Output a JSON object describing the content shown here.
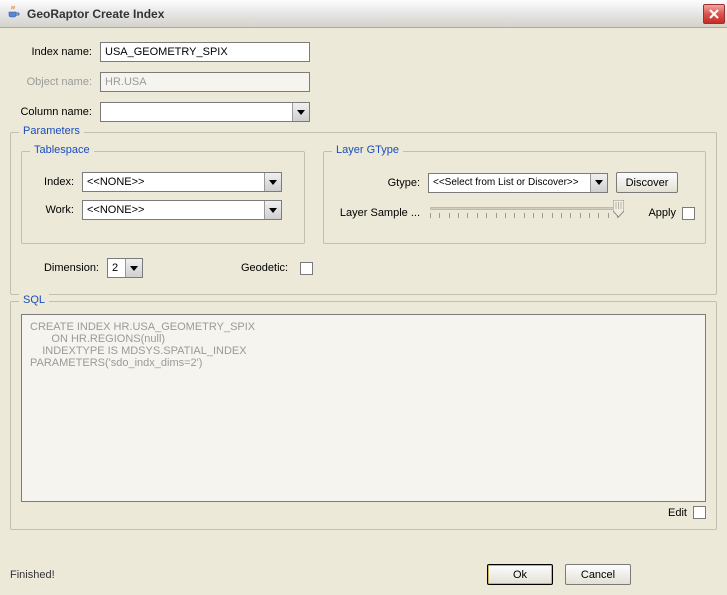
{
  "window": {
    "title": "GeoRaptor Create Index"
  },
  "form": {
    "index_name_label": "Index name:",
    "index_name_value": "USA_GEOMETRY_SPIX",
    "object_name_label": "Object name:",
    "object_name_value": "HR.USA",
    "column_name_label": "Column name:",
    "column_name_value": ""
  },
  "parameters": {
    "legend": "Parameters",
    "tablespace": {
      "legend": "Tablespace",
      "index_label": "Index:",
      "index_value": "<<NONE>>",
      "work_label": "Work:",
      "work_value": "<<NONE>>"
    },
    "gtype": {
      "legend": "Layer GType",
      "gtype_label": "Gtype:",
      "gtype_value": "<<Select from List or Discover>>",
      "discover_label": "Discover",
      "sample_label": "Layer Sample ...",
      "apply_label": "Apply"
    },
    "dimension_label": "Dimension:",
    "dimension_value": "2",
    "geodetic_label": "Geodetic:"
  },
  "sql": {
    "legend": "SQL",
    "text": "CREATE INDEX HR.USA_GEOMETRY_SPIX\n       ON HR.REGIONS(null)\n    INDEXTYPE IS MDSYS.SPATIAL_INDEX\nPARAMETERS('sdo_indx_dims=2')",
    "edit_label": "Edit"
  },
  "footer": {
    "status": "Finished!",
    "ok_label": "Ok",
    "cancel_label": "Cancel"
  }
}
